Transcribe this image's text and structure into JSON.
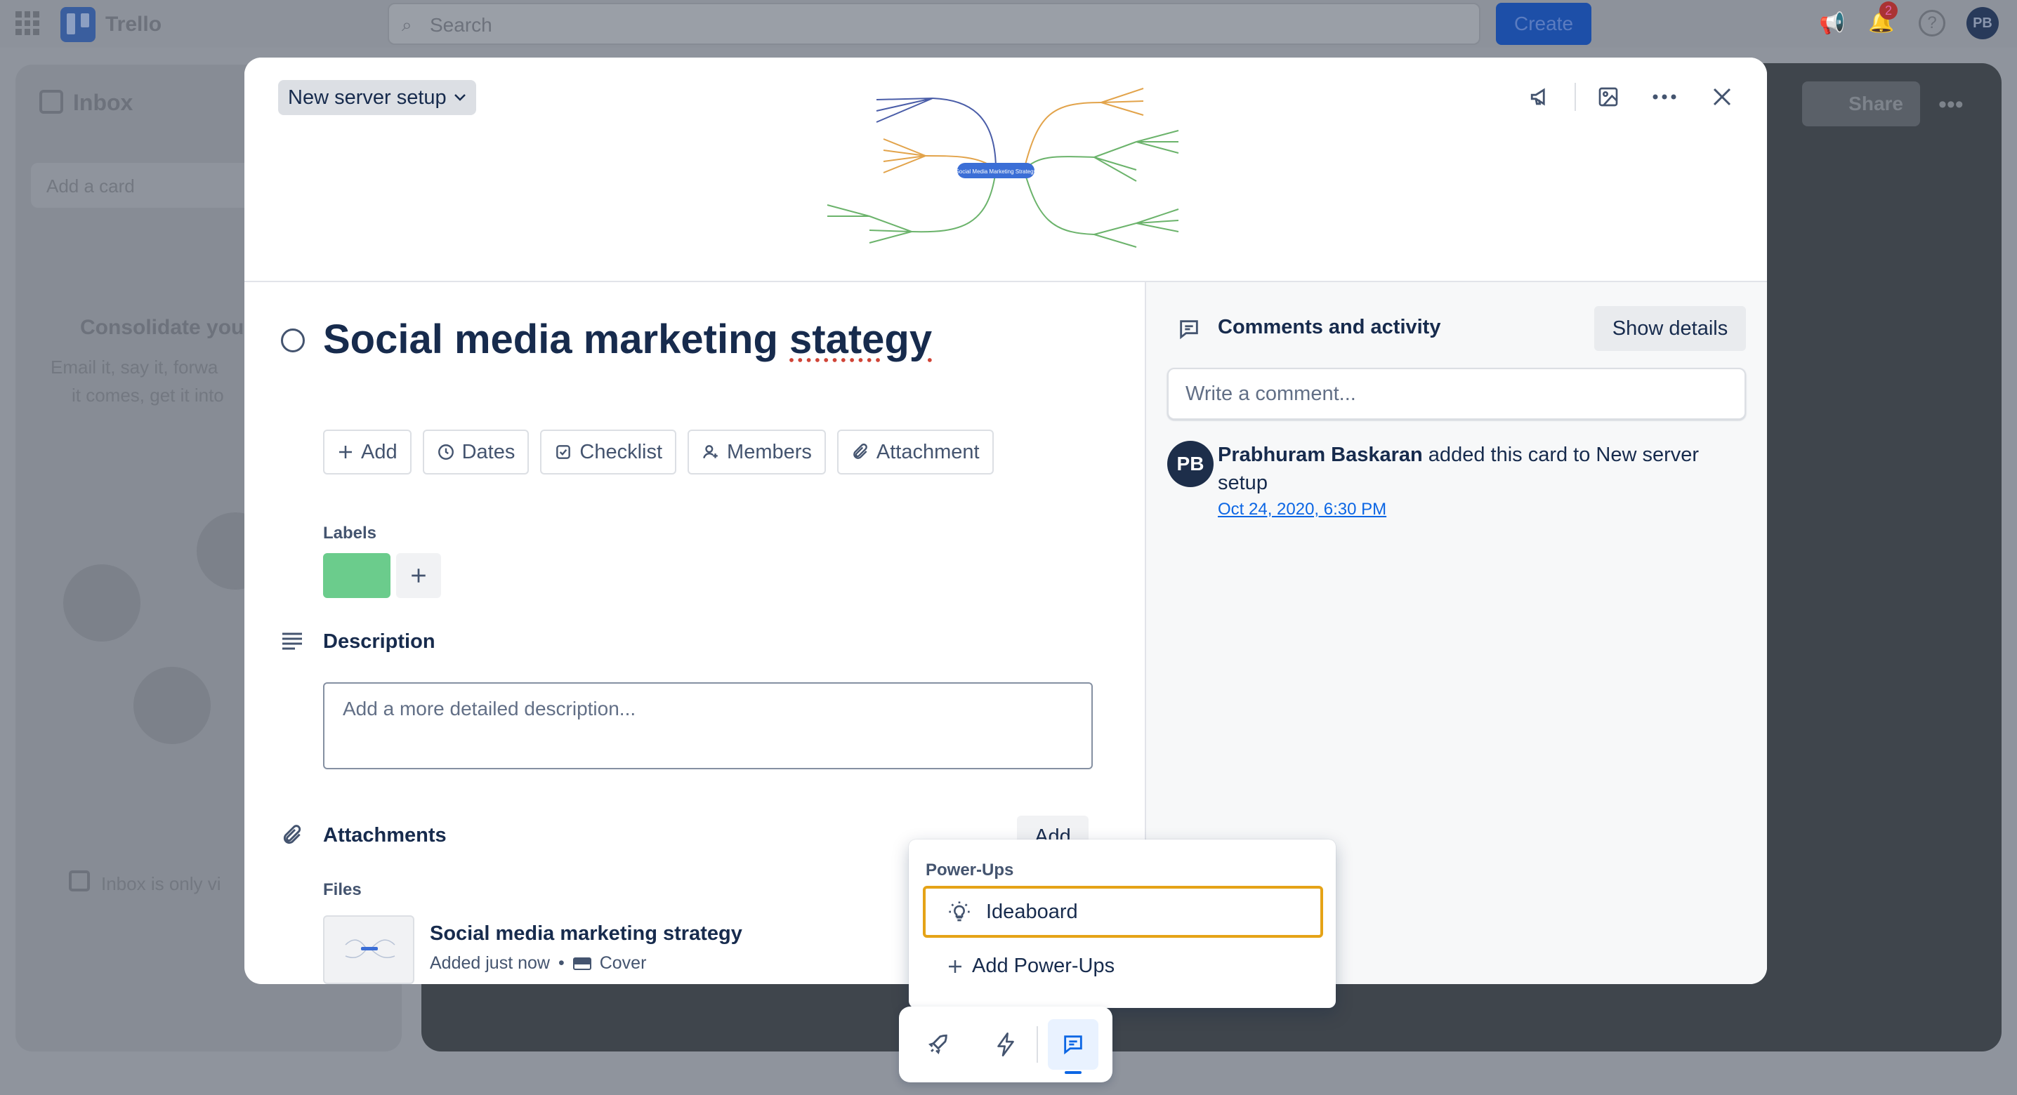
{
  "app": {
    "name": "Trello",
    "search_placeholder": "Search",
    "create_label": "Create",
    "notif_count": "2",
    "user_initials": "PB"
  },
  "background": {
    "inbox_title": "Inbox",
    "add_card": "Add a card",
    "consolidate_title": "Consolidate you",
    "consolidate_text1": "Email it, say it, forwa",
    "consolidate_text2": "it comes, get it into",
    "inbox_private": "Inbox is only vi",
    "share_label": "Share"
  },
  "card": {
    "list_name": "New server setup",
    "title_prefix": "Social media marketing ",
    "title_misspelled": "stategy",
    "actions": [
      {
        "label": "Add",
        "icon": "plus-icon"
      },
      {
        "label": "Dates",
        "icon": "clock-icon"
      },
      {
        "label": "Checklist",
        "icon": "checklist-icon"
      },
      {
        "label": "Members",
        "icon": "add-member-icon"
      },
      {
        "label": "Attachment",
        "icon": "paperclip-icon"
      }
    ],
    "labels_heading": "Labels",
    "label_color": "#6bcc8c",
    "description_heading": "Description",
    "description_placeholder": "Add a more detailed description...",
    "attachments_heading": "Attachments",
    "attachments_add": "Add",
    "files_heading": "Files",
    "file": {
      "name": "Social media marketing strategy",
      "meta": "Added just now",
      "cover": "Cover"
    }
  },
  "mindmap": {
    "center": "Social Media Marketing Strategy"
  },
  "activity": {
    "heading": "Comments and activity",
    "show_details": "Show details",
    "comment_placeholder": "Write a comment...",
    "entry": {
      "initials": "PB",
      "user": "Prabhuram Baskaran",
      "text": " added this card to New server setup",
      "timestamp": "Oct 24, 2020, 6:30 PM"
    }
  },
  "powerups": {
    "heading": "Power-Ups",
    "items": [
      {
        "label": "Ideaboard",
        "icon": "lightbulb-icon"
      }
    ],
    "add_label": "Add Power-Ups"
  },
  "colors": {
    "accent": "#0c66e4",
    "highlight": "#e5a317",
    "avatar": "#1d2e4a"
  }
}
